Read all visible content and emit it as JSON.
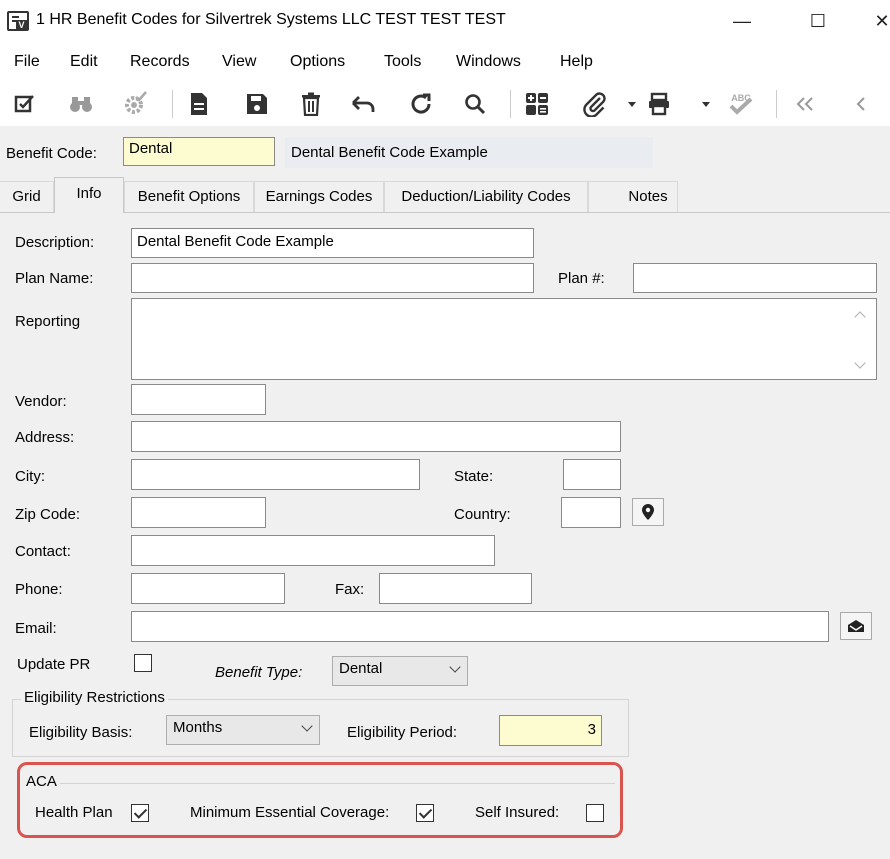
{
  "window": {
    "title": "1 HR Benefit Codes for Silvertrek Systems LLC TEST TEST TEST",
    "minimize": "—",
    "maximize": "☐",
    "close": "✕"
  },
  "menu": [
    "File",
    "Edit",
    "Records",
    "View",
    "Options",
    "Tools",
    "Windows",
    "Help"
  ],
  "toolbar": {
    "spell_label": "ABC"
  },
  "header": {
    "benefit_code_label": "Benefit Code:",
    "benefit_code_value": "Dental",
    "benefit_code_description": "Dental Benefit Code Example"
  },
  "tabs": [
    "Grid",
    "Info",
    "Benefit Options",
    "Earnings Codes",
    "Deduction/Liability Codes",
    "Notes"
  ],
  "info": {
    "description_label": "Description:",
    "description_value": "Dental Benefit Code Example",
    "plan_name_label": "Plan Name:",
    "plan_name_value": "",
    "plan_number_label": "Plan #:",
    "plan_number_value": "",
    "reporting_label": "Reporting",
    "reporting_value": "",
    "vendor_label": "Vendor:",
    "address_label": "Address:",
    "city_label": "City:",
    "state_label": "State:",
    "zip_label": "Zip Code:",
    "country_label": "Country:",
    "contact_label": "Contact:",
    "phone_label": "Phone:",
    "fax_label": "Fax:",
    "email_label": "Email:",
    "update_pr_label": "Update PR",
    "update_pr_checked": false,
    "benefit_type_label": "Benefit Type:",
    "benefit_type_value": "Dental"
  },
  "eligibility": {
    "group_title": "Eligibility Restrictions",
    "basis_label": "Eligibility Basis:",
    "basis_value": "Months",
    "period_label": "Eligibility Period:",
    "period_value": "3"
  },
  "aca": {
    "group_title": "ACA",
    "health_plan_label": "Health Plan",
    "health_plan_checked": true,
    "mec_label": "Minimum Essential Coverage:",
    "mec_checked": true,
    "self_insured_label": "Self Insured:",
    "self_insured_checked": false,
    "highlight_color": "#d9534f"
  }
}
